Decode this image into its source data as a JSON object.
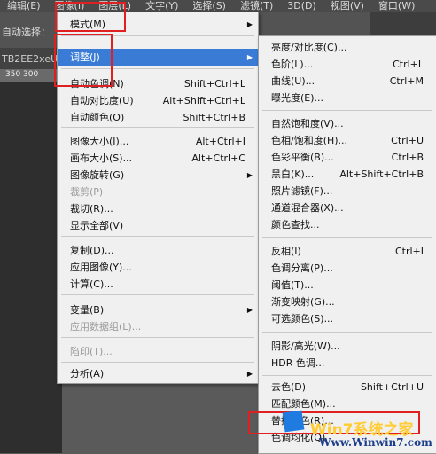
{
  "menubar": [
    "编辑(E)",
    "图像(I)",
    "图层(L)",
    "文字(Y)",
    "选择(S)",
    "滤镜(T)",
    "3D(D)",
    "视图(V)",
    "窗口(W)"
  ],
  "optbar_label": "自动选择：",
  "tab_text": "TB2EE2xeU",
  "ruler_text": "350   300",
  "image_menu": {
    "items": [
      {
        "label": "模式(M)",
        "submenu": true
      },
      {
        "label": "调整(J)",
        "submenu": true,
        "highlighted": true
      },
      {
        "label": "自动色调(N)",
        "shortcut": "Shift+Ctrl+L"
      },
      {
        "label": "自动对比度(U)",
        "shortcut": "Alt+Shift+Ctrl+L"
      },
      {
        "label": "自动颜色(O)",
        "shortcut": "Shift+Ctrl+B"
      },
      {
        "label": "图像大小(I)...",
        "shortcut": "Alt+Ctrl+I"
      },
      {
        "label": "画布大小(S)...",
        "shortcut": "Alt+Ctrl+C"
      },
      {
        "label": "图像旋转(G)",
        "submenu": true
      },
      {
        "label": "裁剪(P)",
        "disabled": true
      },
      {
        "label": "裁切(R)..."
      },
      {
        "label": "显示全部(V)"
      },
      {
        "label": "复制(D)..."
      },
      {
        "label": "应用图像(Y)..."
      },
      {
        "label": "计算(C)..."
      },
      {
        "label": "变量(B)",
        "submenu": true
      },
      {
        "label": "应用数据组(L)...",
        "disabled": true
      },
      {
        "label": "陷印(T)...",
        "disabled": true
      },
      {
        "label": "分析(A)",
        "submenu": true
      }
    ]
  },
  "adjust_menu": {
    "items": [
      {
        "label": "亮度/对比度(C)..."
      },
      {
        "label": "色阶(L)...",
        "shortcut": "Ctrl+L"
      },
      {
        "label": "曲线(U)...",
        "shortcut": "Ctrl+M"
      },
      {
        "label": "曝光度(E)..."
      },
      {
        "label": "自然饱和度(V)..."
      },
      {
        "label": "色相/饱和度(H)...",
        "shortcut": "Ctrl+U"
      },
      {
        "label": "色彩平衡(B)...",
        "shortcut": "Ctrl+B"
      },
      {
        "label": "黑白(K)...",
        "shortcut": "Alt+Shift+Ctrl+B"
      },
      {
        "label": "照片滤镜(F)..."
      },
      {
        "label": "通道混合器(X)..."
      },
      {
        "label": "颜色查找..."
      },
      {
        "label": "反相(I)",
        "shortcut": "Ctrl+I"
      },
      {
        "label": "色调分离(P)..."
      },
      {
        "label": "阈值(T)..."
      },
      {
        "label": "渐变映射(G)..."
      },
      {
        "label": "可选颜色(S)..."
      },
      {
        "label": "阴影/高光(W)..."
      },
      {
        "label": "HDR 色调..."
      },
      {
        "label": "去色(D)",
        "shortcut": "Shift+Ctrl+U"
      },
      {
        "label": "匹配颜色(M)..."
      },
      {
        "label": "替换颜色(R)..."
      },
      {
        "label": "色调均化(Q)"
      }
    ]
  },
  "watermark": {
    "name": "Win7系统之家",
    "url": "Www.Winwin7.com"
  }
}
